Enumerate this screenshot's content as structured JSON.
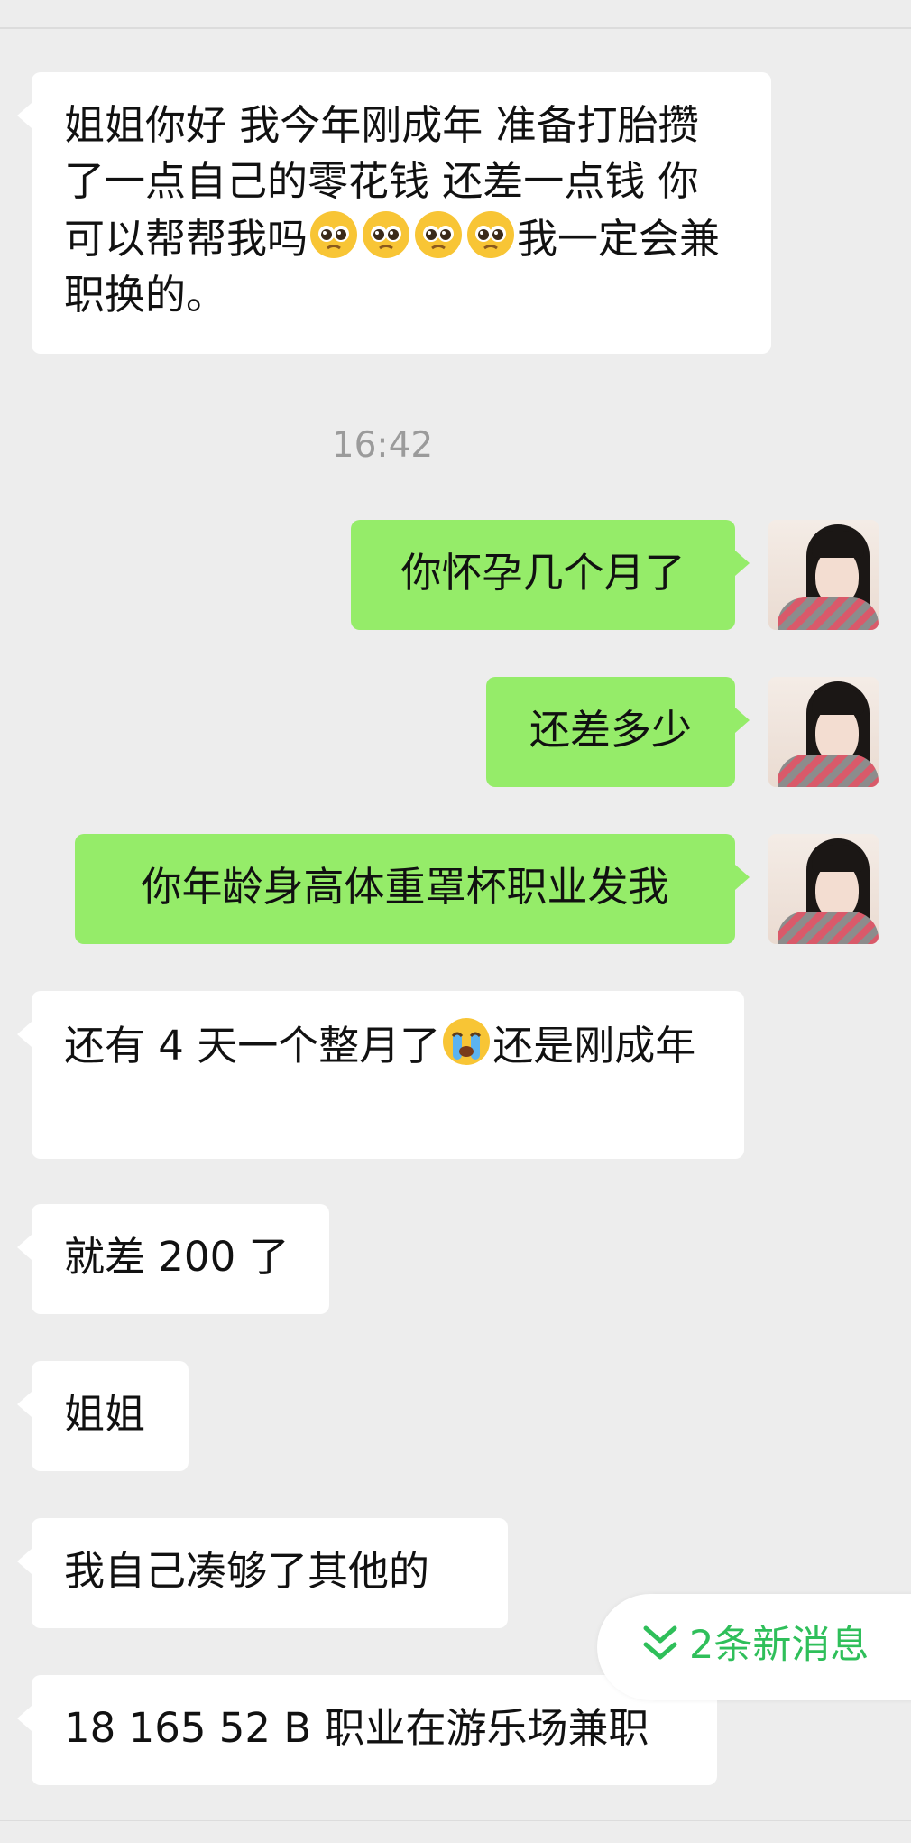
{
  "messages": [
    {
      "side": "left",
      "text_parts": [
        "姐姐你好 我今年刚成年 准备打胎攒了一点自己的零花钱 还差一点钱 你可以帮帮我吗",
        "我一定会兼职换的。"
      ],
      "emoji": "pleading-face"
    },
    {
      "side": "right",
      "text": "你怀孕几个月了"
    },
    {
      "side": "right",
      "text": "还差多少"
    },
    {
      "side": "right",
      "text": "你年龄身高体重罩杯职业发我"
    },
    {
      "side": "left",
      "text_parts": [
        "还有 4 天一个整月了",
        "还是刚成年"
      ],
      "emoji": "loudly-crying-face"
    },
    {
      "side": "left",
      "text": "就差 200 了"
    },
    {
      "side": "left",
      "text": "姐姐"
    },
    {
      "side": "left",
      "text": "我自己凑够了其他的"
    },
    {
      "side": "left",
      "text": "18 165 52 B 职业在游乐场兼职"
    }
  ],
  "timestamp": "16:42",
  "new_messages": {
    "label": "2条新消息",
    "icon": "double-chevron-down-icon"
  },
  "colors": {
    "background": "#ededed",
    "incoming": "#ffffff",
    "outgoing": "#95ec69",
    "accent": "#2fbf5a",
    "timestamp": "#9b9b9b"
  }
}
